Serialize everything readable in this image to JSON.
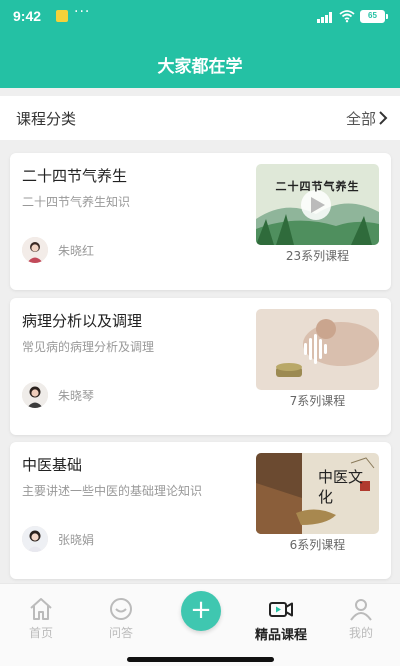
{
  "status_bar": {
    "time": "9:42",
    "more": "···",
    "battery": "65"
  },
  "header": {
    "title": "大家都在学"
  },
  "category": {
    "label": "课程分类",
    "all_label": "全部"
  },
  "courses": [
    {
      "title": "二十四节气养生",
      "description": "二十四节气养生知识",
      "teacher": "朱晓红",
      "series": "23系列课程",
      "thumb_caption": "二十四节气养生"
    },
    {
      "title": "病理分析以及调理",
      "description": "常见病的病理分析及调理",
      "teacher": "朱晓琴",
      "series": "7系列课程"
    },
    {
      "title": "中医基础",
      "description": "主要讲述一些中医的基础理论知识",
      "teacher": "张晓娟",
      "series": "6系列课程",
      "thumb_caption": "中医文化"
    }
  ],
  "nav": {
    "home": "首页",
    "qa": "问答",
    "add": "+",
    "courses": "精品课程",
    "mine": "我的"
  },
  "colors": {
    "primary": "#24c1a4",
    "fab": "#3fc7b0"
  }
}
